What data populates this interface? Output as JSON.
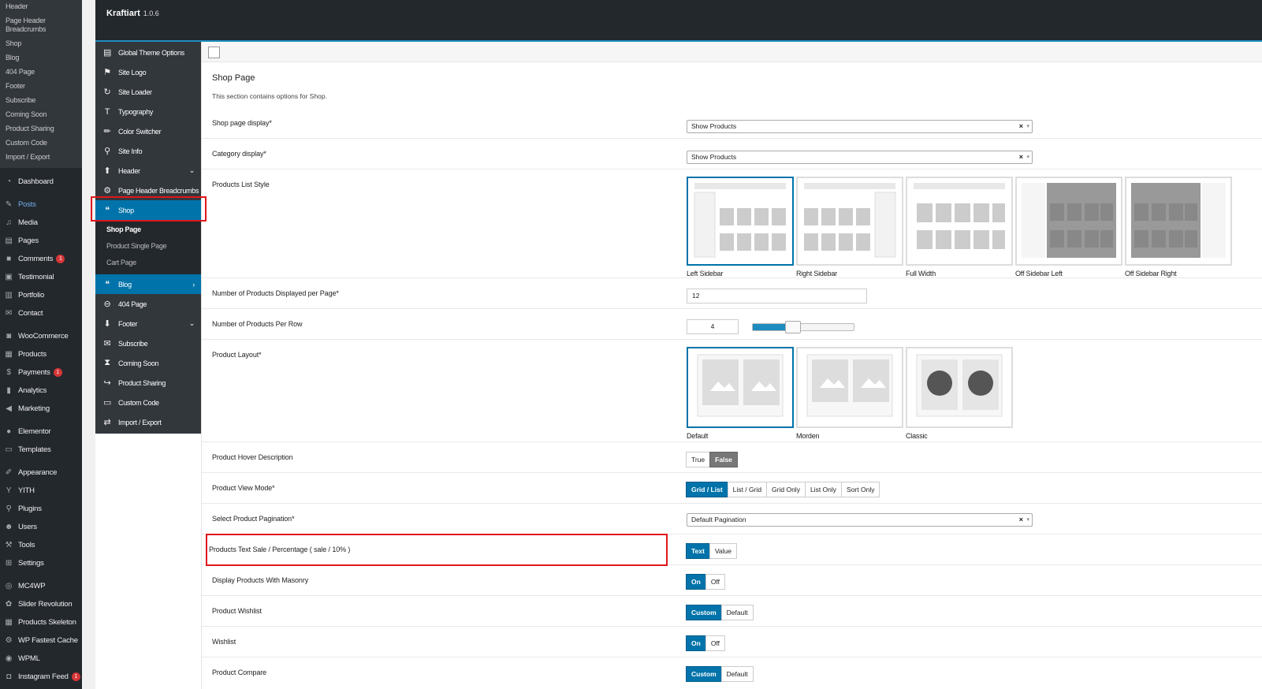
{
  "wp_menu": {
    "submenu": [
      "Header",
      "Page Header Breadcrumbs",
      "Shop",
      "Blog",
      "404 Page",
      "Footer",
      "Subscribe",
      "Coming Soon",
      "Product Sharing",
      "Custom Code",
      "Import / Export"
    ],
    "items": [
      {
        "label": "Dashboard",
        "icon": "dashboard-icon"
      },
      {
        "label": "Posts",
        "icon": "pin-icon"
      },
      {
        "label": "Media",
        "icon": "media-icon"
      },
      {
        "label": "Pages",
        "icon": "pages-icon"
      },
      {
        "label": "Comments",
        "icon": "comment-icon",
        "badge": "1"
      },
      {
        "label": "Testimonial",
        "icon": "testimonial-icon"
      },
      {
        "label": "Portfolio",
        "icon": "portfolio-icon"
      },
      {
        "label": "Contact",
        "icon": "mail-icon"
      },
      {
        "label": "WooCommerce",
        "icon": "woo-icon"
      },
      {
        "label": "Products",
        "icon": "products-icon"
      },
      {
        "label": "Payments",
        "icon": "payments-icon",
        "badge": "1"
      },
      {
        "label": "Analytics",
        "icon": "analytics-icon"
      },
      {
        "label": "Marketing",
        "icon": "marketing-icon"
      },
      {
        "label": "Elementor",
        "icon": "elementor-icon"
      },
      {
        "label": "Templates",
        "icon": "templates-icon"
      },
      {
        "label": "Appearance",
        "icon": "brush-icon"
      },
      {
        "label": "YITH",
        "icon": "yith-icon"
      },
      {
        "label": "Plugins",
        "icon": "plugin-icon"
      },
      {
        "label": "Users",
        "icon": "users-icon"
      },
      {
        "label": "Tools",
        "icon": "tools-icon"
      },
      {
        "label": "Settings",
        "icon": "settings-icon"
      },
      {
        "label": "MC4WP",
        "icon": "mc4wp-icon"
      },
      {
        "label": "Slider Revolution",
        "icon": "slider-icon"
      },
      {
        "label": "Products Skeleton",
        "icon": "skeleton-icon"
      },
      {
        "label": "WP Fastest Cache",
        "icon": "cache-icon"
      },
      {
        "label": "WPML",
        "icon": "wpml-icon"
      },
      {
        "label": "Instagram Feed",
        "icon": "instagram-icon",
        "badge": "1"
      }
    ]
  },
  "header": {
    "title": "Kraftiart",
    "version": "1.0.6"
  },
  "redux_menu": {
    "items": [
      {
        "label": "Global Theme Options",
        "icon": "options-icon"
      },
      {
        "label": "Site Logo",
        "icon": "flag-icon"
      },
      {
        "label": "Site Loader",
        "icon": "refresh-icon"
      },
      {
        "label": "Typography",
        "icon": "text-icon"
      },
      {
        "label": "Color Switcher",
        "icon": "pencil-icon"
      },
      {
        "label": "Site Info",
        "icon": "location-icon"
      },
      {
        "label": "Header",
        "icon": "arrow-up-icon"
      },
      {
        "label": "Page Header Breadcrumbs",
        "icon": "gear-icon"
      },
      {
        "label": "Shop",
        "icon": "shop-icon"
      }
    ],
    "shop_sub": [
      "Shop Page",
      "Product Single Page",
      "Cart Page"
    ],
    "items2": [
      {
        "label": "Blog",
        "icon": "blog-icon"
      },
      {
        "label": "404 Page",
        "icon": "minus-circle-icon"
      },
      {
        "label": "Footer",
        "icon": "arrow-down-icon"
      },
      {
        "label": "Subscribe",
        "icon": "envelope-icon"
      },
      {
        "label": "Coming Soon",
        "icon": "hourglass-icon"
      },
      {
        "label": "Product Sharing",
        "icon": "share-icon"
      },
      {
        "label": "Custom Code",
        "icon": "code-icon"
      },
      {
        "label": "Import / Export",
        "icon": "import-icon"
      }
    ]
  },
  "section": {
    "title": "Shop Page",
    "description": "This section contains options for Shop."
  },
  "fields": {
    "shop_display": {
      "label": "Shop page display*",
      "value": "Show Products"
    },
    "category_display": {
      "label": "Category display*",
      "value": "Show Products"
    },
    "list_style": {
      "label": "Products List Style",
      "options": [
        "Left Sidebar",
        "Right Sidebar",
        "Full Width",
        "Off Sidebar Left",
        "Off Sidebar Right"
      ],
      "selected": "Left Sidebar"
    },
    "per_page": {
      "label": "Number of Products Displayed per Page*",
      "value": "12"
    },
    "per_row": {
      "label": "Number of Products Per Row",
      "value": "4",
      "slider_fraction": 0.4
    },
    "layout": {
      "label": "Product Layout*",
      "options": [
        "Default",
        "Morden",
        "Classic"
      ],
      "selected": "Default"
    },
    "hover_desc": {
      "label": "Product Hover Description",
      "options": [
        "True",
        "False"
      ],
      "selected": "False"
    },
    "view_mode": {
      "label": "Product View Mode*",
      "options": [
        "Grid / List",
        "List / Grid",
        "Grid Only",
        "List Only",
        "Sort Only"
      ],
      "selected": "Grid / List"
    },
    "pagination": {
      "label": "Select Product Pagination*",
      "value": "Default Pagination"
    },
    "sale_text": {
      "label": "Products Text Sale / Percentage ( sale / 10% )",
      "options": [
        "Text",
        "Value"
      ],
      "selected": "Text"
    },
    "masonry": {
      "label": "Display Products With Masonry",
      "options": [
        "On",
        "Off"
      ],
      "selected": "On"
    },
    "wishlist_style": {
      "label": "Product Wishlist",
      "options": [
        "Custom",
        "Default"
      ],
      "selected": "Custom"
    },
    "wishlist": {
      "label": "Wishlist",
      "options": [
        "On",
        "Off"
      ],
      "selected": "On"
    },
    "compare": {
      "label": "Product Compare",
      "options": [
        "Custom",
        "Default"
      ],
      "selected": "Custom"
    }
  },
  "colors": {
    "accent": "#0073aa",
    "highlight": "#e0161c",
    "admin_bg": "#23282d"
  }
}
